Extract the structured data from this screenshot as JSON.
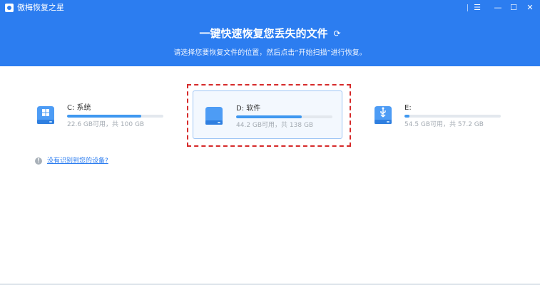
{
  "app": {
    "title": "傲梅恢复之星",
    "headline": "一键快速恢复您丢失的文件",
    "subline": "请选择您要恢复文件的位置，然后点击“开始扫描”进行恢复。"
  },
  "window_controls": {
    "menu": "☰",
    "minimize": "—",
    "maximize": "☐",
    "close": "✕"
  },
  "drives": [
    {
      "name": "C: 系统",
      "capacity": "22.6 GB可用，共 100 GB",
      "used_fraction": 0.77,
      "icon": "windows-drive-icon",
      "selected": false
    },
    {
      "name": "D: 软件",
      "capacity": "44.2 GB可用，共 138 GB",
      "used_fraction": 0.68,
      "icon": "hard-drive-icon",
      "selected": true
    },
    {
      "name": "E:",
      "capacity": "54.5 GB可用，共 57.2 GB",
      "used_fraction": 0.05,
      "icon": "usb-drive-icon",
      "selected": false
    }
  ],
  "help": {
    "link": "没有识别到您的设备?"
  },
  "colors": {
    "header": "#2c7df0",
    "bar_fill": "#3f98f0",
    "highlight": "#d62a2a"
  }
}
